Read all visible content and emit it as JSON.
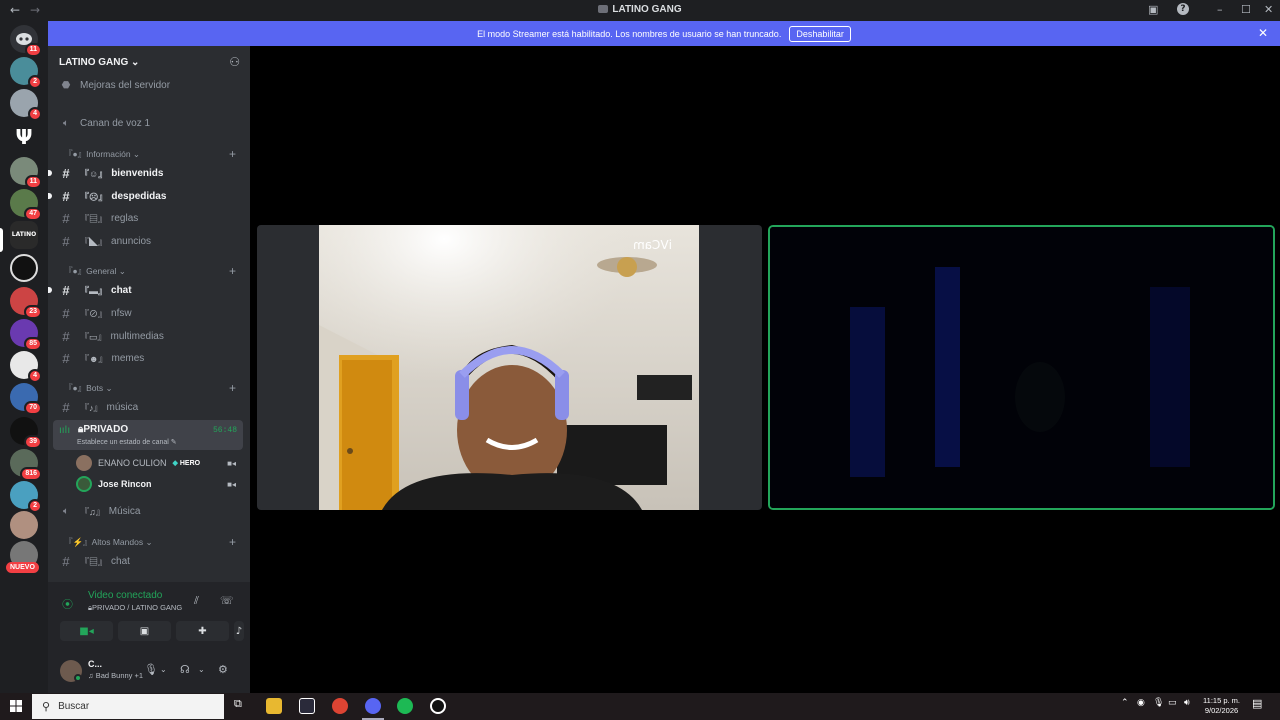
{
  "window": {
    "title": "LATINO GANG"
  },
  "banner": {
    "text": "El modo Streamer está habilitado. Los nombres de usuario se han truncado.",
    "button": "Deshabilitar"
  },
  "rail": {
    "badges": [
      "11",
      "2",
      "4",
      "11",
      "47",
      "23",
      "85",
      "4",
      "70",
      "39",
      "816",
      "2"
    ],
    "nuevo": "NUEVO"
  },
  "server": {
    "name": "LATINO GANG"
  },
  "sidebar": {
    "boosts": "Mejoras del servidor",
    "voice1": "Canan de voz 1",
    "cat_info": "Información",
    "bienvenids": "bienvenids",
    "despedidas": "despedidas",
    "reglas": "reglas",
    "anuncios": "anuncios",
    "cat_general": "General",
    "chat": "chat",
    "nfsw": "nfsw",
    "multimedias": "multimedias",
    "memes": "memes",
    "cat_bots": "Bots",
    "musica1": "música",
    "privado": "PRIVADO",
    "privado_status": "Establece un estado de canal",
    "privado_time": "56:48",
    "user1": "ENANO CULION",
    "user1_tag": "HERO",
    "user2": "Jose Rincon",
    "musica2": "Música",
    "cat_altos": "Altos Mandos",
    "chat2": "chat"
  },
  "voice_panel": {
    "title": "Video conectado",
    "subtitle": "PRIVADO / LATINO GANG"
  },
  "user_panel": {
    "name": "C...",
    "status": "Bad Bunny +1"
  },
  "video": {
    "watermark": "iVCam"
  },
  "taskbar": {
    "search_placeholder": "Buscar",
    "time": "11:15 p. m.",
    "date": "9/02/2026"
  }
}
